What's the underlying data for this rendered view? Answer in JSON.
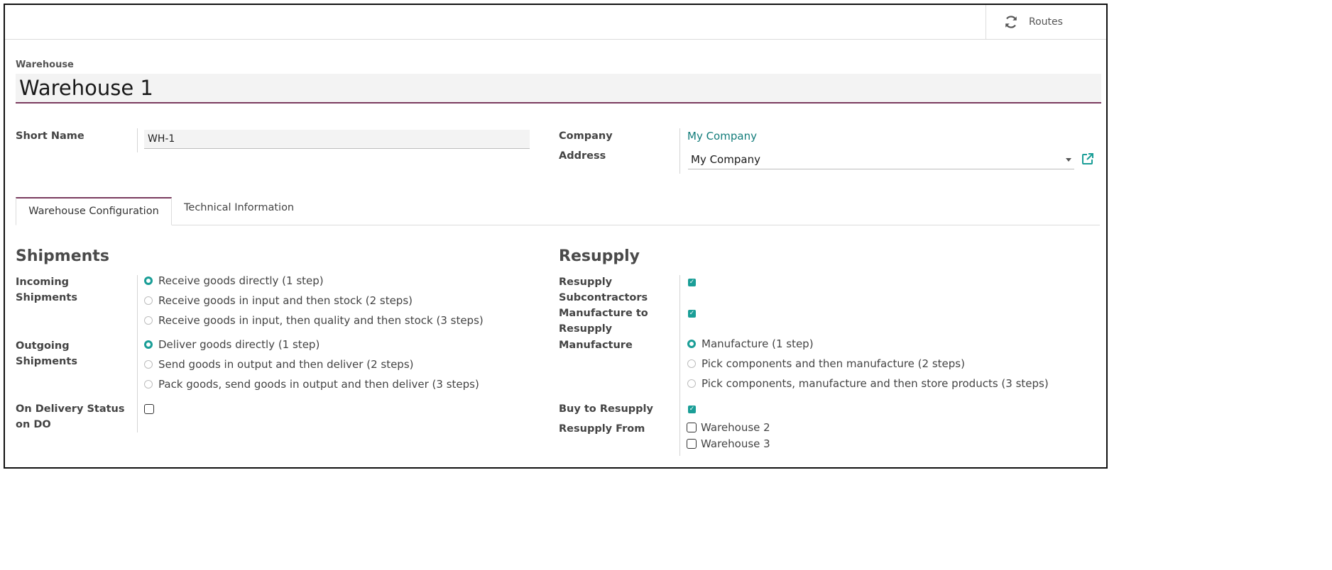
{
  "header": {
    "routes_label": "Routes",
    "routes_icon": "refresh-icon"
  },
  "form": {
    "warehouse_label": "Warehouse",
    "warehouse_name": "Warehouse 1",
    "short_name_label": "Short Name",
    "short_name_value": "WH-1",
    "company_label": "Company",
    "company_value": "My Company",
    "address_label": "Address",
    "address_value": "My Company",
    "external_link_icon": "external-link-icon"
  },
  "tabs": [
    {
      "label": "Warehouse Configuration",
      "active": true
    },
    {
      "label": "Technical Information",
      "active": false
    }
  ],
  "shipments": {
    "title": "Shipments",
    "incoming_label_1": "Incoming",
    "incoming_label_2": "Shipments",
    "incoming_options": [
      {
        "label": "Receive goods directly (1 step)",
        "selected": true
      },
      {
        "label": "Receive goods in input and then stock (2 steps)",
        "selected": false
      },
      {
        "label": "Receive goods in input, then quality and then stock (3 steps)",
        "selected": false
      }
    ],
    "outgoing_label_1": "Outgoing",
    "outgoing_label_2": "Shipments",
    "outgoing_options": [
      {
        "label": "Deliver goods directly (1 step)",
        "selected": true
      },
      {
        "label": "Send goods in output and then deliver (2 steps)",
        "selected": false
      },
      {
        "label": "Pack goods, send goods in output and then deliver (3 steps)",
        "selected": false
      }
    ],
    "delivery_status_label_1": "On Delivery Status",
    "delivery_status_label_2": "on DO",
    "delivery_status_checked": false
  },
  "resupply": {
    "title": "Resupply",
    "subcontractors_label_1": "Resupply",
    "subcontractors_label_2": "Subcontractors",
    "subcontractors_checked": true,
    "manufacture_to_resupply_label_1": "Manufacture to",
    "manufacture_to_resupply_label_2": "Resupply",
    "manufacture_to_resupply_checked": true,
    "manufacture_label": "Manufacture",
    "manufacture_options": [
      {
        "label": "Manufacture (1 step)",
        "selected": true
      },
      {
        "label": "Pick components and then manufacture (2 steps)",
        "selected": false
      },
      {
        "label": "Pick components, manufacture and then store products (3 steps)",
        "selected": false
      }
    ],
    "buy_label": "Buy to Resupply",
    "buy_checked": true,
    "resupply_from_label": "Resupply From",
    "resupply_from_options": [
      {
        "label": "Warehouse 2",
        "checked": false
      },
      {
        "label": "Warehouse 3",
        "checked": false
      }
    ]
  }
}
